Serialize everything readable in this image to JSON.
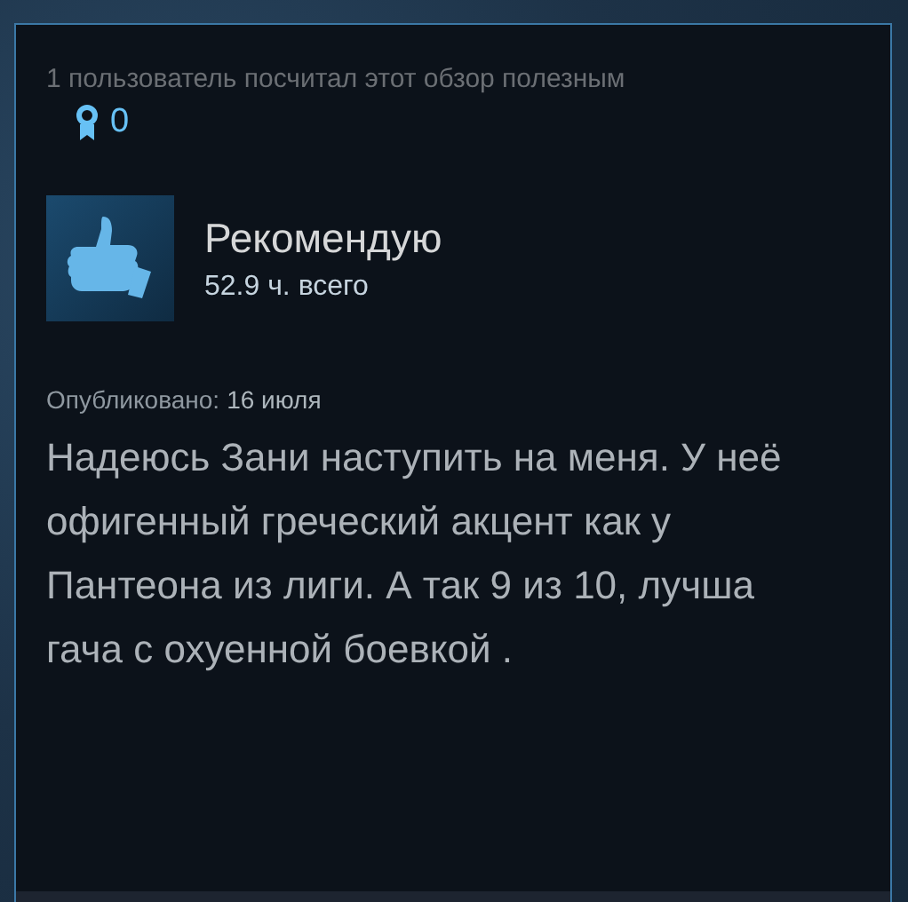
{
  "helpful_text": "1 пользователь посчитал этот обзор полезным",
  "awards": {
    "count": "0"
  },
  "review": {
    "verdict": "Рекомендую",
    "recommended": true,
    "hours": "52.9 ч. всего"
  },
  "published": {
    "label": "Опубликовано:",
    "date": "16 июля"
  },
  "body": "Надеюсь Зани наступить на меня. У неё офигенный греческий акцент как у Пантеона из лиги. А так 9 из 10, лучша гача с охуенной боевкой ."
}
